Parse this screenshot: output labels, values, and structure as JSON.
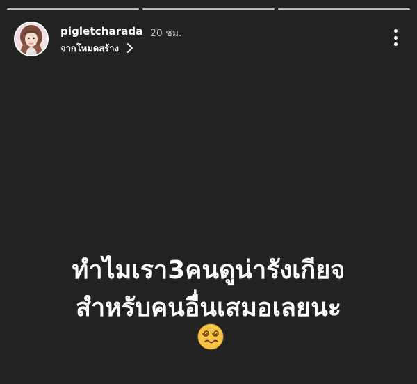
{
  "story": {
    "username": "pigletcharada",
    "time": "20 ชม.",
    "subtitle": "จากโหมดสร้าง",
    "progress_segments": 3,
    "caption_lines": [
      "ทำไมเรา3คนดูน่ารังเกียจ",
      "สำหรับคนอื่นเสมอเลยนะ"
    ],
    "emoji": "face-with-spiral-eyes-icon"
  },
  "colors": {
    "background": "#222222",
    "text": "#ffffff",
    "muted_text": "#c8c8c8",
    "progress": "#bdbdbd",
    "emoji_face": "#f6c444"
  }
}
